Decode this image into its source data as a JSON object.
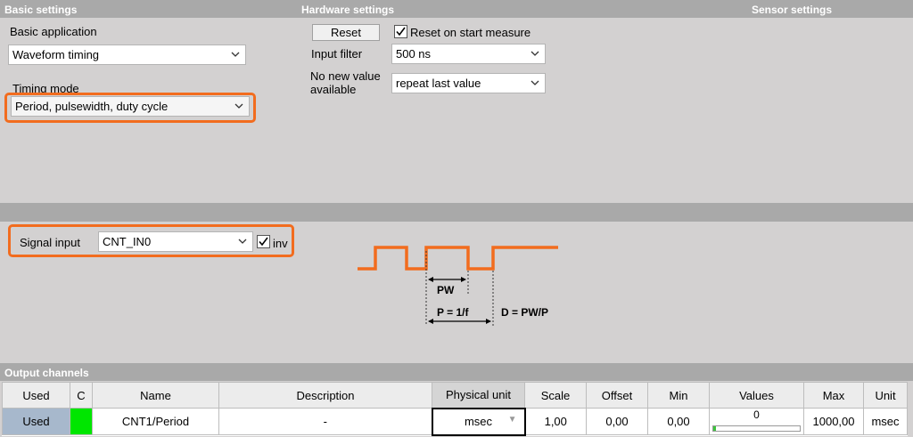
{
  "basic_settings": {
    "header": "Basic settings",
    "application_label": "Basic application",
    "application_value": "Waveform timing",
    "timing_mode_label": "Timing mode",
    "timing_mode_value": "Period, pulsewidth, duty cycle"
  },
  "hardware_settings": {
    "header": "Hardware settings",
    "reset_button": "Reset",
    "reset_on_start_label": "Reset on start measure",
    "reset_on_start_checked": true,
    "input_filter_label": "Input filter",
    "input_filter_value": "500 ns",
    "no_new_value_label_line1": "No new value",
    "no_new_value_label_line2": "available",
    "no_new_value_value": "repeat last value"
  },
  "sensor_settings": {
    "header": "Sensor settings"
  },
  "signal": {
    "label": "Signal input",
    "value": "CNT_IN0",
    "inv_label": "inv",
    "inv_checked": true
  },
  "diagram": {
    "pw_label": "PW",
    "p_label": "P = 1/f",
    "d_label": "D = PW/P",
    "waveform_color": "#f26c1e"
  },
  "output_channels": {
    "header": "Output channels",
    "columns": [
      "Used",
      "C",
      "Name",
      "Description",
      "Physical unit",
      "Scale",
      "Offset",
      "Min",
      "Values",
      "Max",
      "Unit"
    ],
    "rows": [
      {
        "used": "Used",
        "color": "#00e600",
        "name": "CNT1/Period",
        "description": "-",
        "physical_unit": "msec",
        "scale": "1,00",
        "offset": "0,00",
        "min": "0,00",
        "value": "0",
        "value_fraction": 0.0,
        "max": "1000,00",
        "unit": "msec"
      }
    ]
  },
  "colors": {
    "highlight": "#f26c1e",
    "section_header": "#a9a9a9",
    "panel": "#d3d1d1"
  }
}
